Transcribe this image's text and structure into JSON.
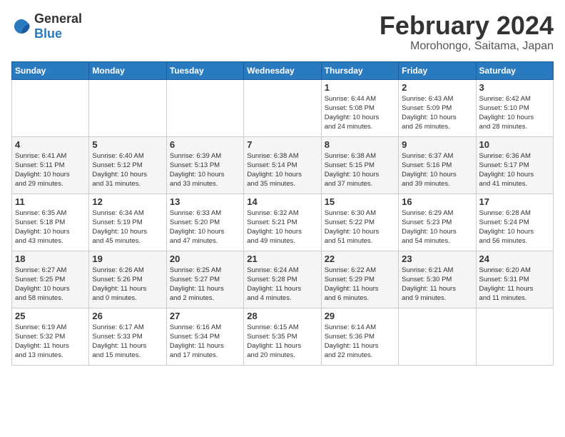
{
  "logo": {
    "general": "General",
    "blue": "Blue"
  },
  "title": "February 2024",
  "subtitle": "Morohongo, Saitama, Japan",
  "days_of_week": [
    "Sunday",
    "Monday",
    "Tuesday",
    "Wednesday",
    "Thursday",
    "Friday",
    "Saturday"
  ],
  "weeks": [
    [
      {
        "day": "",
        "info": ""
      },
      {
        "day": "",
        "info": ""
      },
      {
        "day": "",
        "info": ""
      },
      {
        "day": "",
        "info": ""
      },
      {
        "day": "1",
        "info": "Sunrise: 6:44 AM\nSunset: 5:08 PM\nDaylight: 10 hours\nand 24 minutes."
      },
      {
        "day": "2",
        "info": "Sunrise: 6:43 AM\nSunset: 5:09 PM\nDaylight: 10 hours\nand 26 minutes."
      },
      {
        "day": "3",
        "info": "Sunrise: 6:42 AM\nSunset: 5:10 PM\nDaylight: 10 hours\nand 28 minutes."
      }
    ],
    [
      {
        "day": "4",
        "info": "Sunrise: 6:41 AM\nSunset: 5:11 PM\nDaylight: 10 hours\nand 29 minutes."
      },
      {
        "day": "5",
        "info": "Sunrise: 6:40 AM\nSunset: 5:12 PM\nDaylight: 10 hours\nand 31 minutes."
      },
      {
        "day": "6",
        "info": "Sunrise: 6:39 AM\nSunset: 5:13 PM\nDaylight: 10 hours\nand 33 minutes."
      },
      {
        "day": "7",
        "info": "Sunrise: 6:38 AM\nSunset: 5:14 PM\nDaylight: 10 hours\nand 35 minutes."
      },
      {
        "day": "8",
        "info": "Sunrise: 6:38 AM\nSunset: 5:15 PM\nDaylight: 10 hours\nand 37 minutes."
      },
      {
        "day": "9",
        "info": "Sunrise: 6:37 AM\nSunset: 5:16 PM\nDaylight: 10 hours\nand 39 minutes."
      },
      {
        "day": "10",
        "info": "Sunrise: 6:36 AM\nSunset: 5:17 PM\nDaylight: 10 hours\nand 41 minutes."
      }
    ],
    [
      {
        "day": "11",
        "info": "Sunrise: 6:35 AM\nSunset: 5:18 PM\nDaylight: 10 hours\nand 43 minutes."
      },
      {
        "day": "12",
        "info": "Sunrise: 6:34 AM\nSunset: 5:19 PM\nDaylight: 10 hours\nand 45 minutes."
      },
      {
        "day": "13",
        "info": "Sunrise: 6:33 AM\nSunset: 5:20 PM\nDaylight: 10 hours\nand 47 minutes."
      },
      {
        "day": "14",
        "info": "Sunrise: 6:32 AM\nSunset: 5:21 PM\nDaylight: 10 hours\nand 49 minutes."
      },
      {
        "day": "15",
        "info": "Sunrise: 6:30 AM\nSunset: 5:22 PM\nDaylight: 10 hours\nand 51 minutes."
      },
      {
        "day": "16",
        "info": "Sunrise: 6:29 AM\nSunset: 5:23 PM\nDaylight: 10 hours\nand 54 minutes."
      },
      {
        "day": "17",
        "info": "Sunrise: 6:28 AM\nSunset: 5:24 PM\nDaylight: 10 hours\nand 56 minutes."
      }
    ],
    [
      {
        "day": "18",
        "info": "Sunrise: 6:27 AM\nSunset: 5:25 PM\nDaylight: 10 hours\nand 58 minutes."
      },
      {
        "day": "19",
        "info": "Sunrise: 6:26 AM\nSunset: 5:26 PM\nDaylight: 11 hours\nand 0 minutes."
      },
      {
        "day": "20",
        "info": "Sunrise: 6:25 AM\nSunset: 5:27 PM\nDaylight: 11 hours\nand 2 minutes."
      },
      {
        "day": "21",
        "info": "Sunrise: 6:24 AM\nSunset: 5:28 PM\nDaylight: 11 hours\nand 4 minutes."
      },
      {
        "day": "22",
        "info": "Sunrise: 6:22 AM\nSunset: 5:29 PM\nDaylight: 11 hours\nand 6 minutes."
      },
      {
        "day": "23",
        "info": "Sunrise: 6:21 AM\nSunset: 5:30 PM\nDaylight: 11 hours\nand 9 minutes."
      },
      {
        "day": "24",
        "info": "Sunrise: 6:20 AM\nSunset: 5:31 PM\nDaylight: 11 hours\nand 11 minutes."
      }
    ],
    [
      {
        "day": "25",
        "info": "Sunrise: 6:19 AM\nSunset: 5:32 PM\nDaylight: 11 hours\nand 13 minutes."
      },
      {
        "day": "26",
        "info": "Sunrise: 6:17 AM\nSunset: 5:33 PM\nDaylight: 11 hours\nand 15 minutes."
      },
      {
        "day": "27",
        "info": "Sunrise: 6:16 AM\nSunset: 5:34 PM\nDaylight: 11 hours\nand 17 minutes."
      },
      {
        "day": "28",
        "info": "Sunrise: 6:15 AM\nSunset: 5:35 PM\nDaylight: 11 hours\nand 20 minutes."
      },
      {
        "day": "29",
        "info": "Sunrise: 6:14 AM\nSunset: 5:36 PM\nDaylight: 11 hours\nand 22 minutes."
      },
      {
        "day": "",
        "info": ""
      },
      {
        "day": "",
        "info": ""
      }
    ]
  ]
}
